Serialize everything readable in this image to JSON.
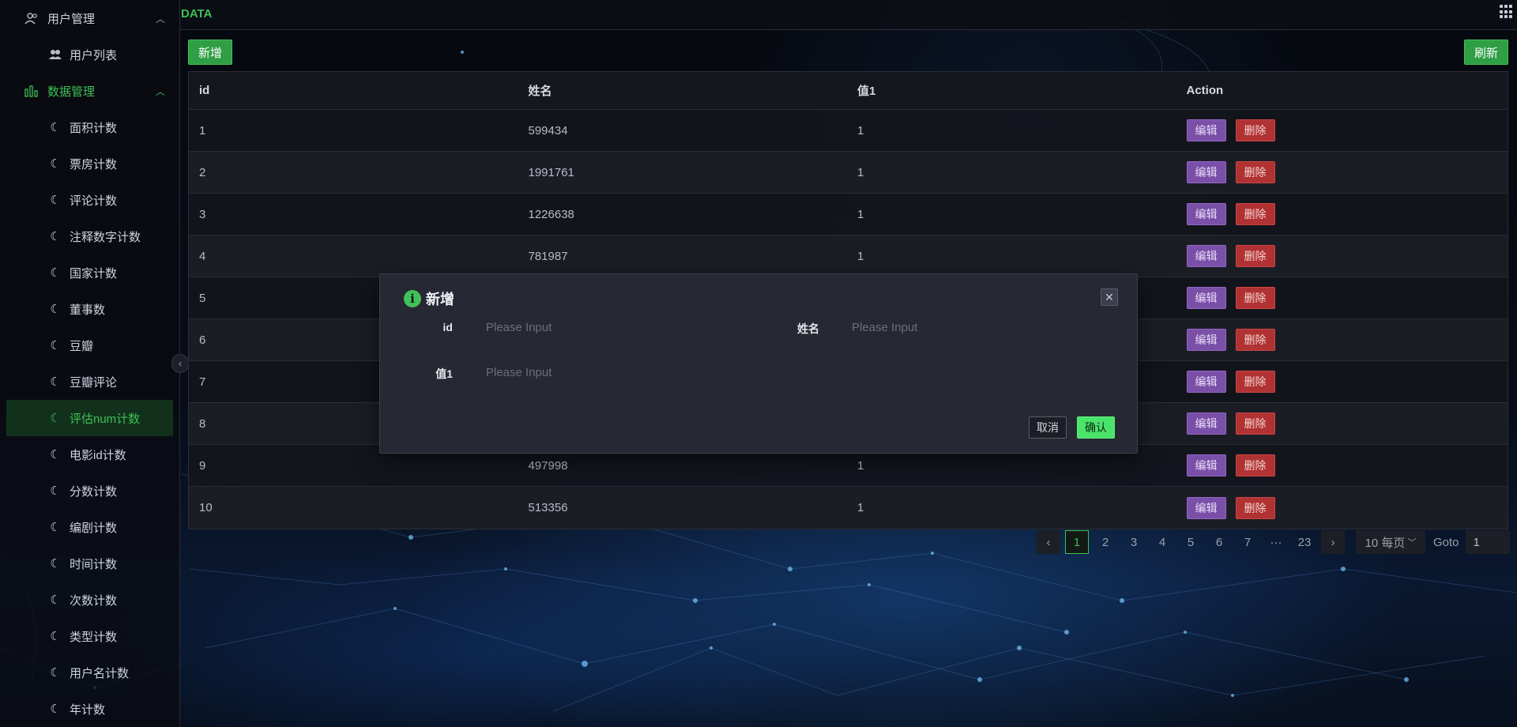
{
  "sidebar": {
    "group_user": {
      "label": "用户管理",
      "icon": "users-icon"
    },
    "user_items": [
      {
        "label": "用户列表",
        "icon": "user-group-icon"
      }
    ],
    "group_data": {
      "label": "数据管理",
      "icon": "bar-chart-icon"
    },
    "data_items": [
      {
        "label": "面积计数"
      },
      {
        "label": "票房计数"
      },
      {
        "label": "评论计数"
      },
      {
        "label": "注释数字计数"
      },
      {
        "label": "国家计数"
      },
      {
        "label": "董事数"
      },
      {
        "label": "豆瓣"
      },
      {
        "label": "豆瓣评论"
      },
      {
        "label": "评估num计数",
        "active": true
      },
      {
        "label": "电影id计数"
      },
      {
        "label": "分数计数"
      },
      {
        "label": "编剧计数"
      },
      {
        "label": "时间计数"
      },
      {
        "label": "次数计数"
      },
      {
        "label": "类型计数"
      },
      {
        "label": "用户名计数"
      },
      {
        "label": "年计数"
      }
    ]
  },
  "header": {
    "title": "DATA"
  },
  "toolbar": {
    "add_label": "新增",
    "refresh_label": "刷新"
  },
  "table": {
    "columns": [
      "id",
      "姓名",
      "值1",
      "Action"
    ],
    "rows": [
      {
        "id": "1",
        "name": "599434",
        "value1": "1"
      },
      {
        "id": "2",
        "name": "1991761",
        "value1": "1"
      },
      {
        "id": "3",
        "name": "1226638",
        "value1": "1"
      },
      {
        "id": "4",
        "name": "781987",
        "value1": "1"
      },
      {
        "id": "5",
        "name": "",
        "value1": ""
      },
      {
        "id": "6",
        "name": "",
        "value1": ""
      },
      {
        "id": "7",
        "name": "",
        "value1": ""
      },
      {
        "id": "8",
        "name": "",
        "value1": ""
      },
      {
        "id": "9",
        "name": "497998",
        "value1": "1"
      },
      {
        "id": "10",
        "name": "513356",
        "value1": "1"
      }
    ],
    "edit_label": "编辑",
    "delete_label": "删除"
  },
  "pagination": {
    "prev": "‹",
    "pages": [
      "1",
      "2",
      "3",
      "4",
      "5",
      "6",
      "7",
      "···",
      "23"
    ],
    "next": "›",
    "page_size": "10 每页",
    "goto_label": "Goto",
    "goto_value": "1"
  },
  "modal": {
    "title": "新增",
    "fields": {
      "id_label": "id",
      "id_placeholder": "Please Input",
      "name_label": "姓名",
      "name_placeholder": "Please Input",
      "value1_label": "值1",
      "value1_placeholder": "Please Input"
    },
    "cancel_label": "取消",
    "confirm_label": "确认"
  },
  "colors": {
    "accent": "#3fbf55",
    "edit": "#7a4fa8",
    "delete": "#b03232",
    "confirm": "#4be36a"
  }
}
